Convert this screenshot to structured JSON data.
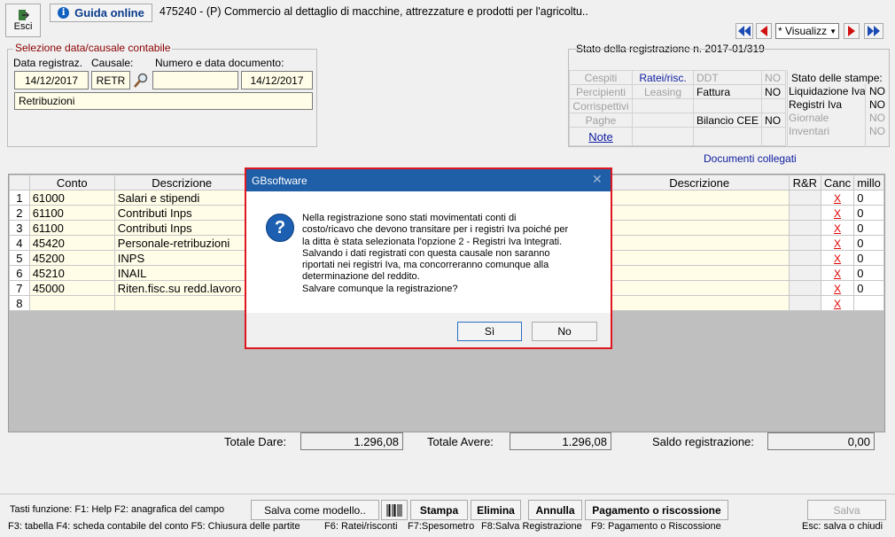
{
  "toolbar": {
    "exit_label": "Esci",
    "guide_label": "Guida online",
    "title": "475240 - (P) Commercio al dettaglio di macchine, attrezzature e prodotti per l'agricoltu..",
    "view_select": "* Visualizz"
  },
  "selection": {
    "group_title": "Selezione data/causale contabile",
    "date_label": "Data registraz.",
    "causal_label": "Causale:",
    "doc_label": "Numero e data documento:",
    "date_value": "14/12/2017",
    "causal_value": "RETR",
    "doc_number": "",
    "doc_date": "14/12/2017",
    "description": "Retribuzioni"
  },
  "status": {
    "title": "Stato della registrazione n. 2017-01/319",
    "cespiti": "Cespiti",
    "ratei": "Ratei/risc.",
    "ddt": "DDT",
    "ddt_val": "NO",
    "percipienti": "Percipienti",
    "leasing": "Leasing",
    "fattura": "Fattura",
    "fattura_val": "NO",
    "corrispettivi": "Corrispettivi",
    "paghe": "Paghe",
    "bilancio": "Bilancio CEE",
    "bilancio_val": "NO",
    "note": "Note",
    "stampe_title": "Stato delle stampe:",
    "liq_iva": "Liquidazione Iva",
    "liq_iva_val": "NO",
    "reg_iva": "Registri Iva",
    "reg_iva_val": "NO",
    "giornale": "Giornale",
    "giornale_val": "NO",
    "inventari": "Inventari",
    "inventari_val": "NO"
  },
  "linked_docs": "Documenti collegati",
  "table": {
    "headers": {
      "conto": "Conto",
      "descrizione": "Descrizione",
      "descrizione2": "Descrizione",
      "rr": "R&R",
      "canc": "Canc",
      "millo": "millo"
    },
    "rows": [
      {
        "n": "1",
        "conto": "61000",
        "descr": "Salari e stipendi",
        "x": "X",
        "m": "0"
      },
      {
        "n": "2",
        "conto": "61100",
        "descr": "Contributi Inps",
        "x": "X",
        "m": "0"
      },
      {
        "n": "3",
        "conto": "61100",
        "descr": "Contributi Inps",
        "x": "X",
        "m": "0"
      },
      {
        "n": "4",
        "conto": "45420",
        "descr": "Personale-retribuzioni",
        "x": "X",
        "m": "0"
      },
      {
        "n": "5",
        "conto": "45200",
        "descr": "INPS",
        "x": "X",
        "m": "0"
      },
      {
        "n": "6",
        "conto": "45210",
        "descr": "INAIL",
        "x": "X",
        "m": "0"
      },
      {
        "n": "7",
        "conto": "45000",
        "descr": "Riten.fisc.su redd.lavoro",
        "x": "X",
        "m": "0"
      },
      {
        "n": "8",
        "conto": "",
        "descr": "",
        "x": "X",
        "m": ""
      }
    ]
  },
  "totals": {
    "dare_label": "Totale Dare:",
    "dare_value": "1.296,08",
    "avere_label": "Totale Avere:",
    "avere_value": "1.296,08",
    "saldo_label": "Saldo registrazione:",
    "saldo_value": "0,00"
  },
  "bottom": {
    "keys1": "Tasti funzione:  F1: Help  F2: anagrafica del campo",
    "keys2": "F3: tabella   F4: scheda contabile del conto  F5: Chiusura delle partite",
    "keys2b": "F6: Ratei/risconti",
    "keys2c": "F7:Spesometro",
    "keys2d": "F8:Salva Registrazione",
    "keys2e": "F9: Pagamento o Riscossione",
    "keys2f": "Esc: salva o chiudi",
    "save_model": "Salva come modello..",
    "stampa": "Stampa",
    "elimina": "Elimina",
    "annulla": "Annulla",
    "pagamento": "Pagamento o riscossione",
    "salva": "Salva"
  },
  "dialog": {
    "title": "GBsoftware",
    "message_lines": [
      "Nella registrazione sono stati movimentati conti di",
      "costo/ricavo che devono transitare per i registri Iva poiché per",
      "la ditta è stata selezionata l'opzione 2 - Registri Iva Integrati.",
      "Salvando i dati registrati con questa causale non saranno",
      "riportati nei registri Iva, ma concorreranno comunque alla",
      "determinazione del reddito.",
      "Salvare comunque la registrazione?"
    ],
    "yes": "Sì",
    "no": "No"
  }
}
